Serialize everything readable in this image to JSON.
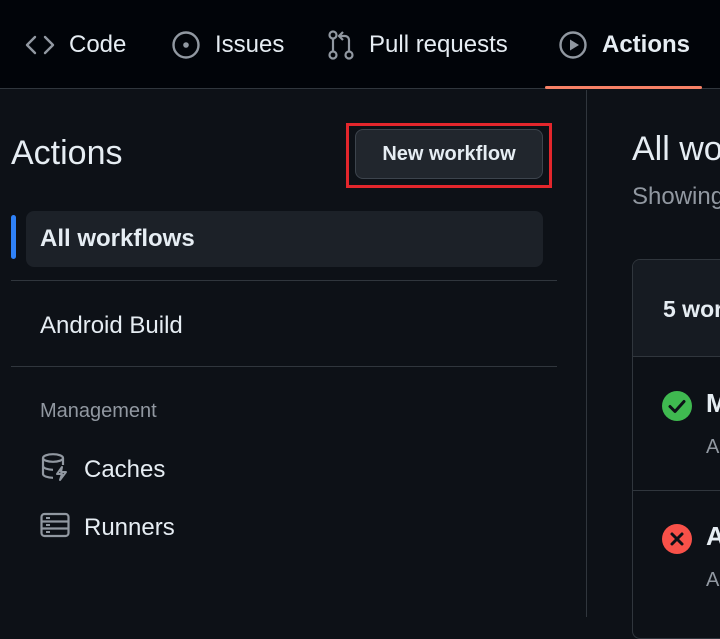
{
  "topnav": {
    "tabs": [
      {
        "label": "Code",
        "icon": "code-icon",
        "active": false
      },
      {
        "label": "Issues",
        "icon": "issue-opened-icon",
        "active": false
      },
      {
        "label": "Pull requests",
        "icon": "git-pull-request-icon",
        "active": false
      },
      {
        "label": "Actions",
        "icon": "play-icon",
        "active": true
      }
    ],
    "active_underline_color": "#f78166"
  },
  "sidebar": {
    "title": "Actions",
    "new_workflow_label": "New workflow",
    "highlight_color": "#e3262c",
    "workflows": [
      {
        "label": "All workflows",
        "selected": true
      },
      {
        "label": "Android Build",
        "selected": false
      }
    ],
    "management_label": "Management",
    "management_items": [
      {
        "label": "Caches",
        "icon": "database-icon"
      },
      {
        "label": "Runners",
        "icon": "server-icon"
      }
    ]
  },
  "main": {
    "title": "All wo",
    "subtitle": "Showing",
    "count_label": "5 wor",
    "runs": [
      {
        "status": "success",
        "status_icon": "check-circle-icon",
        "title": "M",
        "sub": "A",
        "status_color": "#3fb950"
      },
      {
        "status": "failure",
        "status_icon": "x-circle-icon",
        "title": "A",
        "sub": "A",
        "status_color": "#f85149"
      }
    ]
  }
}
